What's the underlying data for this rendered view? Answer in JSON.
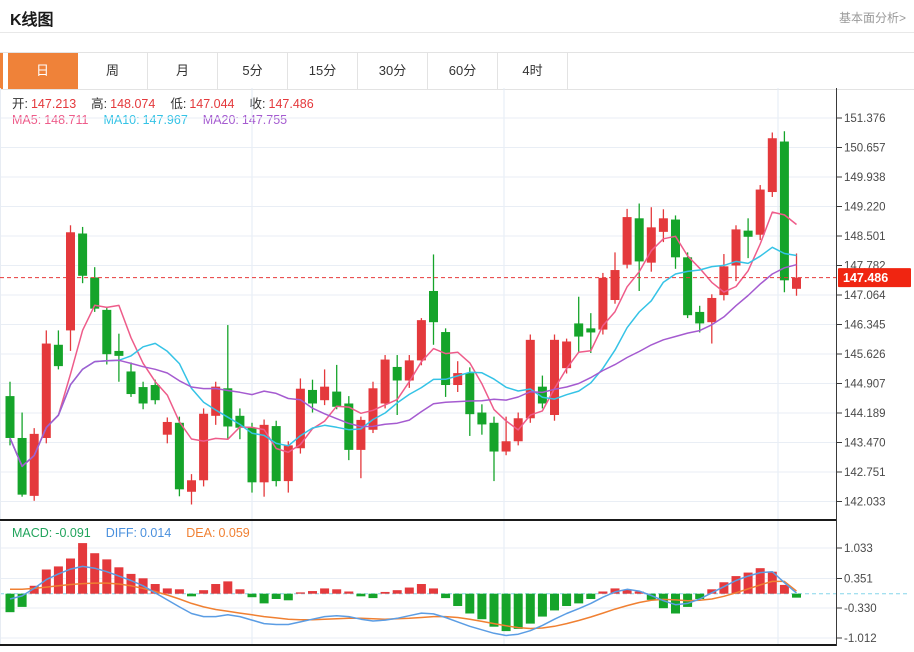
{
  "header": {
    "title": "K线图",
    "link": "基本面分析>"
  },
  "tabs": {
    "items": [
      "日",
      "周",
      "月",
      "5分",
      "15分",
      "30分",
      "60分",
      "4时"
    ],
    "active_index": 0
  },
  "legend": {
    "ohlc": [
      {
        "key": "open",
        "label": "开:",
        "value": "147.213"
      },
      {
        "key": "high",
        "label": "高:",
        "value": "148.074"
      },
      {
        "key": "low",
        "label": "低:",
        "value": "147.044"
      },
      {
        "key": "close",
        "label": "收:",
        "value": "147.486"
      }
    ],
    "ma": [
      {
        "key": "ma5",
        "label": "MA5:",
        "value": "148.711",
        "color": "#ee5c8a"
      },
      {
        "key": "ma10",
        "label": "MA10:",
        "value": "147.967",
        "color": "#35c3e6"
      },
      {
        "key": "ma20",
        "label": "MA20:",
        "value": "147.755",
        "color": "#a55bd0"
      }
    ],
    "macd": [
      {
        "key": "macd",
        "label": "MACD:",
        "value": "-0.091",
        "color": "#21a45c"
      },
      {
        "key": "diff",
        "label": "DIFF:",
        "value": "0.014",
        "color": "#4a90dd"
      },
      {
        "key": "dea",
        "label": "DEA:",
        "value": "0.059",
        "color": "#f08032"
      }
    ]
  },
  "colors": {
    "up": "#e4393c",
    "down": "#15a42a",
    "ma5": "#ee5c8a",
    "ma10": "#35c3e6",
    "ma20": "#a55bd0",
    "diff": "#5b9de4",
    "dea": "#f08032",
    "badge": "#f02511",
    "price_line": "#e83a3a",
    "accent": "#ef8239",
    "zero_line": "#85d6ea",
    "grid": "#e9eef5",
    "vgrid": "#e3ebf5",
    "axis": "#3a3a3a"
  },
  "chart_data": {
    "type": "candlestick",
    "title": "K线图",
    "legend_position": "top-left",
    "grid": true,
    "price_axis_ticks": [
      151.376,
      150.657,
      149.938,
      149.22,
      148.501,
      147.782,
      147.064,
      146.345,
      145.626,
      144.907,
      144.189,
      143.47,
      142.751,
      142.033
    ],
    "last_price": "147.486",
    "last_price_value": 147.486,
    "candles": [
      [
        144.6,
        144.95,
        143.4,
        143.58
      ],
      [
        143.58,
        144.2,
        142.15,
        142.2
      ],
      [
        142.17,
        143.82,
        142.05,
        143.68
      ],
      [
        143.58,
        146.2,
        143.45,
        145.88
      ],
      [
        145.85,
        146.2,
        145.25,
        145.33
      ],
      [
        146.2,
        148.76,
        145.7,
        148.59
      ],
      [
        148.56,
        148.72,
        147.35,
        147.53
      ],
      [
        147.49,
        147.74,
        146.65,
        146.73
      ],
      [
        146.7,
        146.78,
        145.37,
        145.62
      ],
      [
        145.7,
        146.12,
        144.95,
        145.58
      ],
      [
        145.2,
        145.42,
        144.58,
        144.65
      ],
      [
        144.82,
        144.95,
        144.28,
        144.42
      ],
      [
        144.87,
        145.0,
        144.4,
        144.5
      ],
      [
        143.66,
        144.08,
        143.45,
        143.97
      ],
      [
        143.95,
        144.1,
        142.16,
        142.33
      ],
      [
        142.27,
        142.7,
        141.96,
        142.55
      ],
      [
        142.55,
        144.3,
        142.4,
        144.17
      ],
      [
        144.12,
        144.95,
        143.9,
        144.83
      ],
      [
        144.79,
        146.33,
        143.55,
        143.86
      ],
      [
        144.12,
        144.3,
        143.55,
        143.83
      ],
      [
        143.83,
        143.95,
        142.25,
        142.5
      ],
      [
        142.5,
        144.03,
        142.15,
        143.9
      ],
      [
        143.87,
        144.0,
        142.4,
        142.53
      ],
      [
        142.53,
        143.5,
        142.25,
        143.4
      ],
      [
        143.33,
        145.03,
        143.2,
        144.78
      ],
      [
        144.75,
        145.0,
        144.2,
        144.42
      ],
      [
        144.5,
        145.25,
        144.38,
        144.83
      ],
      [
        144.71,
        145.36,
        144.28,
        144.34
      ],
      [
        144.42,
        144.6,
        143.04,
        143.29
      ],
      [
        143.29,
        144.1,
        142.6,
        144.02
      ],
      [
        143.78,
        144.95,
        143.7,
        144.79
      ],
      [
        144.42,
        145.6,
        144.3,
        145.49
      ],
      [
        145.31,
        145.6,
        144.14,
        144.98
      ],
      [
        144.98,
        145.6,
        144.8,
        145.47
      ],
      [
        145.47,
        146.5,
        145.35,
        146.45
      ],
      [
        147.16,
        148.05,
        145.85,
        146.4
      ],
      [
        146.16,
        146.25,
        144.58,
        144.87
      ],
      [
        144.87,
        145.45,
        144.7,
        145.16
      ],
      [
        145.16,
        145.3,
        143.63,
        144.16
      ],
      [
        144.2,
        144.4,
        143.66,
        143.91
      ],
      [
        143.95,
        144.1,
        142.53,
        143.25
      ],
      [
        143.25,
        144.1,
        143.16,
        143.5
      ],
      [
        143.5,
        144.2,
        143.4,
        144.06
      ],
      [
        144.06,
        146.1,
        143.95,
        145.97
      ],
      [
        144.83,
        145.1,
        144.3,
        144.42
      ],
      [
        144.14,
        146.1,
        144.0,
        145.97
      ],
      [
        145.28,
        146.0,
        145.15,
        145.93
      ],
      [
        146.37,
        147.02,
        145.68,
        146.05
      ],
      [
        146.25,
        146.62,
        145.65,
        146.15
      ],
      [
        146.22,
        147.6,
        146.1,
        147.48
      ],
      [
        146.94,
        148.1,
        146.85,
        147.67
      ],
      [
        147.8,
        149.16,
        147.71,
        148.96
      ],
      [
        148.93,
        149.29,
        147.16,
        147.88
      ],
      [
        147.85,
        149.2,
        147.63,
        148.71
      ],
      [
        148.6,
        149.15,
        148.35,
        148.93
      ],
      [
        148.9,
        149.0,
        147.7,
        147.98
      ],
      [
        147.98,
        148.1,
        146.5,
        146.57
      ],
      [
        146.65,
        146.8,
        146.15,
        146.37
      ],
      [
        146.4,
        147.08,
        145.88,
        146.99
      ],
      [
        147.06,
        148.06,
        146.93,
        147.76
      ],
      [
        147.78,
        148.76,
        147.4,
        148.66
      ],
      [
        148.63,
        148.93,
        147.96,
        148.48
      ],
      [
        148.53,
        149.74,
        148.4,
        149.63
      ],
      [
        149.57,
        151.02,
        149.45,
        150.88
      ],
      [
        150.8,
        151.05,
        147.13,
        147.42
      ],
      [
        147.213,
        148.074,
        147.044,
        147.486
      ]
    ],
    "macd_axis_ticks": [
      1.033,
      0.351,
      -0.33,
      -1.012
    ],
    "macd_hist": [
      -0.42,
      -0.3,
      0.18,
      0.55,
      0.62,
      0.8,
      1.15,
      0.92,
      0.78,
      0.6,
      0.45,
      0.35,
      0.22,
      0.12,
      0.1,
      -0.06,
      0.08,
      0.22,
      0.28,
      0.1,
      -0.08,
      -0.22,
      -0.12,
      -0.15,
      0.03,
      0.06,
      0.12,
      0.1,
      0.05,
      -0.06,
      -0.1,
      0.04,
      0.08,
      0.14,
      0.22,
      0.12,
      -0.1,
      -0.28,
      -0.45,
      -0.58,
      -0.75,
      -0.85,
      -0.8,
      -0.68,
      -0.52,
      -0.38,
      -0.28,
      -0.22,
      -0.12,
      0.05,
      0.12,
      0.09,
      0.05,
      -0.14,
      -0.33,
      -0.45,
      -0.3,
      -0.12,
      0.1,
      0.26,
      0.4,
      0.48,
      0.58,
      0.5,
      0.2,
      -0.09
    ],
    "diff_line": [
      -0.12,
      -0.05,
      0.12,
      0.32,
      0.45,
      0.56,
      0.62,
      0.58,
      0.5,
      0.4,
      0.3,
      0.18,
      0.02,
      -0.14,
      -0.3,
      -0.45,
      -0.52,
      -0.52,
      -0.48,
      -0.52,
      -0.6,
      -0.68,
      -0.7,
      -0.7,
      -0.64,
      -0.58,
      -0.52,
      -0.5,
      -0.52,
      -0.58,
      -0.62,
      -0.6,
      -0.56,
      -0.5,
      -0.44,
      -0.46,
      -0.54,
      -0.64,
      -0.74,
      -0.82,
      -0.9,
      -0.95,
      -0.92,
      -0.84,
      -0.72,
      -0.58,
      -0.45,
      -0.34,
      -0.22,
      -0.08,
      0.04,
      0.1,
      0.06,
      -0.04,
      -0.16,
      -0.25,
      -0.22,
      -0.12,
      0.02,
      0.16,
      0.3,
      0.4,
      0.48,
      0.5,
      0.25,
      0.014
    ],
    "dea_line": [
      0.1,
      0.1,
      0.12,
      0.15,
      0.18,
      0.21,
      0.23,
      0.24,
      0.24,
      0.22,
      0.18,
      0.12,
      0.05,
      -0.03,
      -0.12,
      -0.22,
      -0.3,
      -0.36,
      -0.4,
      -0.44,
      -0.48,
      -0.52,
      -0.55,
      -0.58,
      -0.59,
      -0.59,
      -0.58,
      -0.57,
      -0.56,
      -0.56,
      -0.57,
      -0.58,
      -0.57,
      -0.56,
      -0.54,
      -0.52,
      -0.52,
      -0.54,
      -0.58,
      -0.63,
      -0.68,
      -0.73,
      -0.77,
      -0.79,
      -0.78,
      -0.74,
      -0.68,
      -0.61,
      -0.53,
      -0.44,
      -0.35,
      -0.27,
      -0.2,
      -0.15,
      -0.13,
      -0.14,
      -0.16,
      -0.15,
      -0.12,
      -0.06,
      0.02,
      0.11,
      0.2,
      0.28,
      0.28,
      0.059
    ]
  }
}
